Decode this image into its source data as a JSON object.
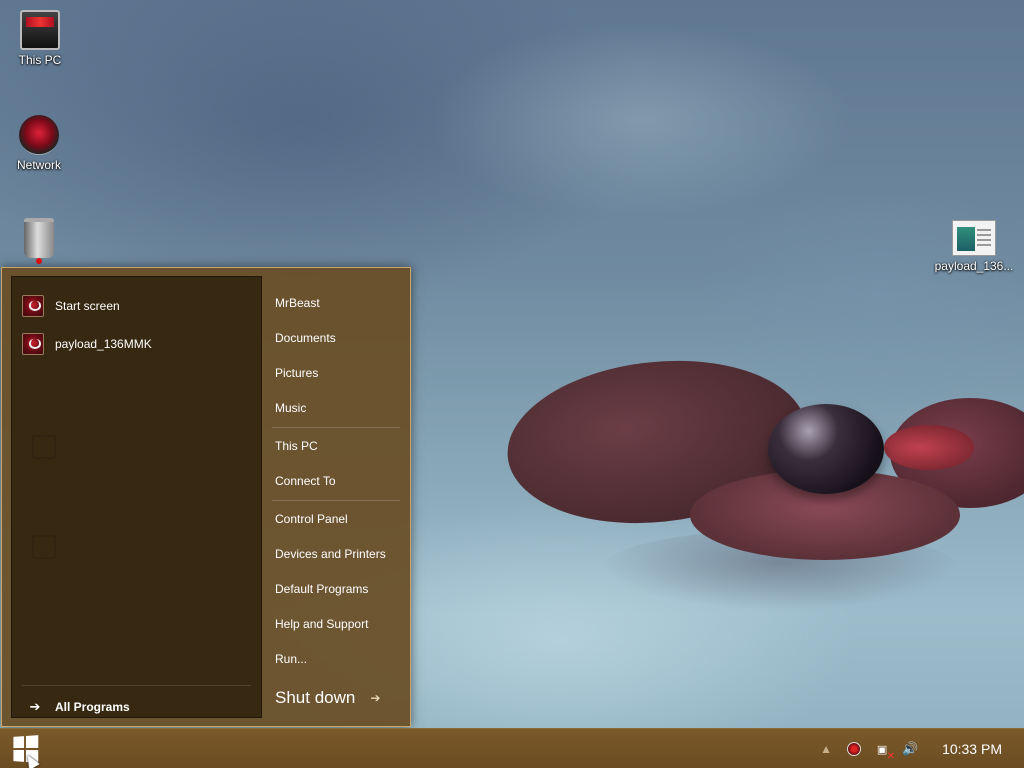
{
  "desktop": {
    "icons": [
      {
        "label": "This PC",
        "icon": "computer-icon"
      },
      {
        "label": "Network",
        "icon": "network-icon"
      },
      {
        "label": "",
        "icon": "recycle-bin-icon"
      },
      {
        "label": "payload_136...",
        "icon": "executable-file-icon"
      }
    ]
  },
  "start_menu": {
    "pinned_programs": [
      {
        "label": "Start screen",
        "icon": "app-shield-icon"
      },
      {
        "label": "payload_136MMK",
        "icon": "app-shield-icon"
      }
    ],
    "all_programs_label": "All Programs",
    "places": [
      {
        "label": "MrBeast"
      },
      {
        "label": "Documents"
      },
      {
        "label": "Pictures"
      },
      {
        "label": "Music"
      },
      {
        "label": "This PC"
      },
      {
        "label": "Connect To"
      },
      {
        "label": "Control Panel"
      },
      {
        "label": "Devices and Printers"
      },
      {
        "label": "Default Programs"
      },
      {
        "label": "Help and Support"
      },
      {
        "label": "Run..."
      }
    ],
    "shutdown_label": "Shut down"
  },
  "taskbar": {
    "start_icon": "windows-logo-icon",
    "tray_icons": [
      "chevron-up-icon",
      "security-icon",
      "network-disconnected-icon",
      "volume-icon"
    ],
    "clock": "10:33 PM"
  },
  "colors": {
    "menu_background": "#694e26",
    "programs_pane": "#30220e",
    "taskbar": "#6b4c22",
    "accent": "#c9a76a"
  }
}
